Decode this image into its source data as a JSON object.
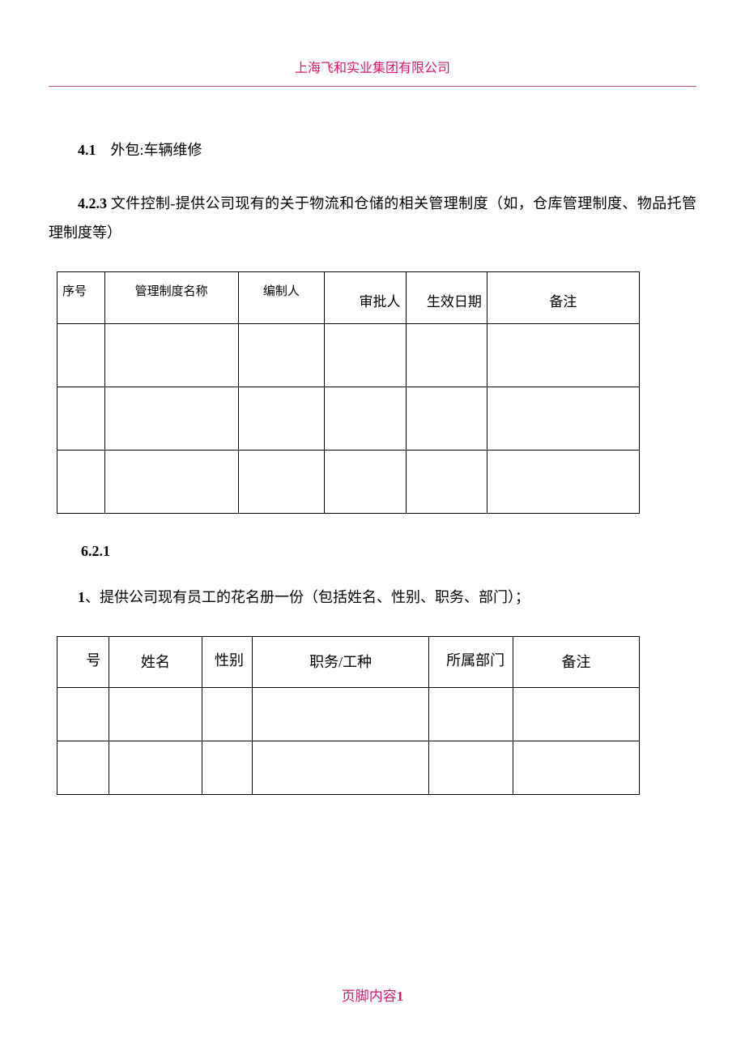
{
  "header": {
    "company": "上海飞和实业集团有限公司"
  },
  "section41": {
    "num": "4.1",
    "sep": "　",
    "label": "外包:",
    "text": "车辆维修"
  },
  "section423": {
    "num": "4.2.3",
    "label": " 文件控制-",
    "text": "提供公司现有的关于物流和仓储的相关管理制度（如，仓库管理制度、物品托管理制度等）"
  },
  "table1": {
    "headers": {
      "c1": "序号",
      "c2": "管理制度名称",
      "c3": "编制人",
      "c4": "审批人",
      "c5": "生效日期",
      "c6": "备注"
    }
  },
  "section621": {
    "num": "6.2.1"
  },
  "para_roster": {
    "num": "1",
    "text": "、提供公司现有员工的花名册一份（包括姓名、性别、职务、部门）；"
  },
  "table2": {
    "headers": {
      "c1": "号",
      "c2": "姓名",
      "c3": "性别",
      "c4": "职务/工种",
      "c5": "所属部门",
      "c6": "备注"
    }
  },
  "footer": {
    "text": "页脚内容",
    "page": "1"
  }
}
